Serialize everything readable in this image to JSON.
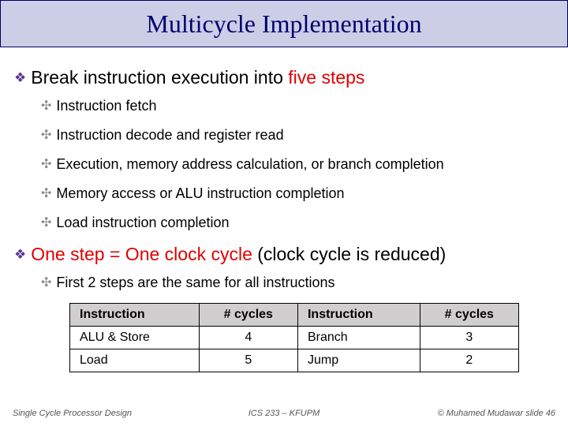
{
  "title": "Multicycle Implementation",
  "bullets": {
    "b1_prefix": "Break instruction execution into ",
    "b1_highlight": "five steps",
    "b1a": "Instruction fetch",
    "b1b": "Instruction decode and register read",
    "b1c": "Execution, memory address calculation, or branch completion",
    "b1d": "Memory access or ALU instruction completion",
    "b1e": "Load instruction completion",
    "b2_highlight": "One step = One clock cycle",
    "b2_suffix": " (clock cycle is reduced)",
    "b2a": "First 2 steps are the same for all instructions"
  },
  "table": {
    "h1": "Instruction",
    "h2": "# cycles",
    "h3": "Instruction",
    "h4": "# cycles",
    "r1c1": "ALU & Store",
    "r1c2": "4",
    "r1c3": "Branch",
    "r1c4": "3",
    "r2c1": "Load",
    "r2c2": "5",
    "r2c3": "Jump",
    "r2c4": "2"
  },
  "footer": {
    "left": "Single Cycle Processor Design",
    "center": "ICS 233 – KFUPM",
    "right": "© Muhamed Mudawar   slide 46"
  }
}
